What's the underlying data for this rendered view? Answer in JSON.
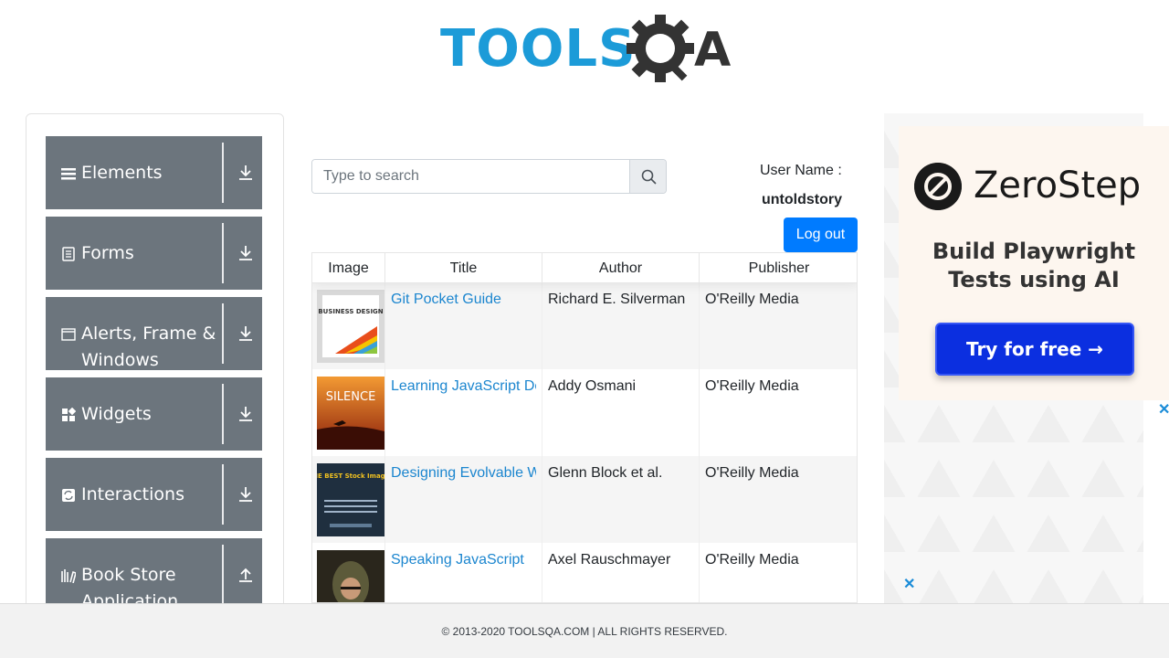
{
  "header": {
    "logo_text": "TOOLSQA",
    "logo_part1": "TOOLS",
    "logo_part2": "A"
  },
  "sidebar": {
    "groups": [
      {
        "label": "Elements",
        "icon": "hamburger-icon",
        "arrow": "download-arrow-icon"
      },
      {
        "label": "Forms",
        "icon": "form-icon",
        "arrow": "download-arrow-icon"
      },
      {
        "label": "Alerts, Frame & Windows",
        "icon": "window-icon",
        "arrow": "download-arrow-icon"
      },
      {
        "label": "Widgets",
        "icon": "widgets-icon",
        "arrow": "download-arrow-icon"
      },
      {
        "label": "Interactions",
        "icon": "interactions-icon",
        "arrow": "download-arrow-icon"
      },
      {
        "label": "Book Store Application",
        "icon": "books-icon",
        "arrow": "upload-arrow-icon"
      }
    ]
  },
  "search": {
    "placeholder": "Type to search",
    "value": ""
  },
  "user": {
    "label": "User Name :",
    "name": "untoldstory",
    "logout_label": "Log out"
  },
  "table": {
    "headers": [
      "Image",
      "Title",
      "Author",
      "Publisher"
    ],
    "rows": [
      {
        "title": "Git Pocket Guide",
        "author": "Richard E. Silverman",
        "publisher": "O'Reilly Media",
        "cover_text": "BUSINESS DESIGN"
      },
      {
        "title": "Learning JavaScript Design Patterns",
        "author": "Addy Osmani",
        "publisher": "O'Reilly Media",
        "cover_text": "SILENCE"
      },
      {
        "title": "Designing Evolvable Web APIs with ASP.NET",
        "author": "Glenn Block et al.",
        "publisher": "O'Reilly Media",
        "cover_text": "THE BEST Stock Images"
      },
      {
        "title": "Speaking JavaScript",
        "author": "Axel Rauschmayer",
        "publisher": "O'Reilly Media",
        "cover_text": ""
      }
    ]
  },
  "ad": {
    "brand": "ZeroStep",
    "tagline": "Build Playwright Tests using AI",
    "tagline_line1": "Build Playwright",
    "tagline_line2": "Tests using AI",
    "cta": "Try for free →",
    "close": "✕"
  },
  "footer": {
    "text": "© 2013-2020 TOOLSQA.COM | ALL RIGHTS RESERVED."
  },
  "colors": {
    "sidebar_group": "#6c757d",
    "primary": "#007bff",
    "link": "#1c86cf",
    "logo_blue": "#1c9bd8",
    "ad_button": "#0b2fe0"
  }
}
